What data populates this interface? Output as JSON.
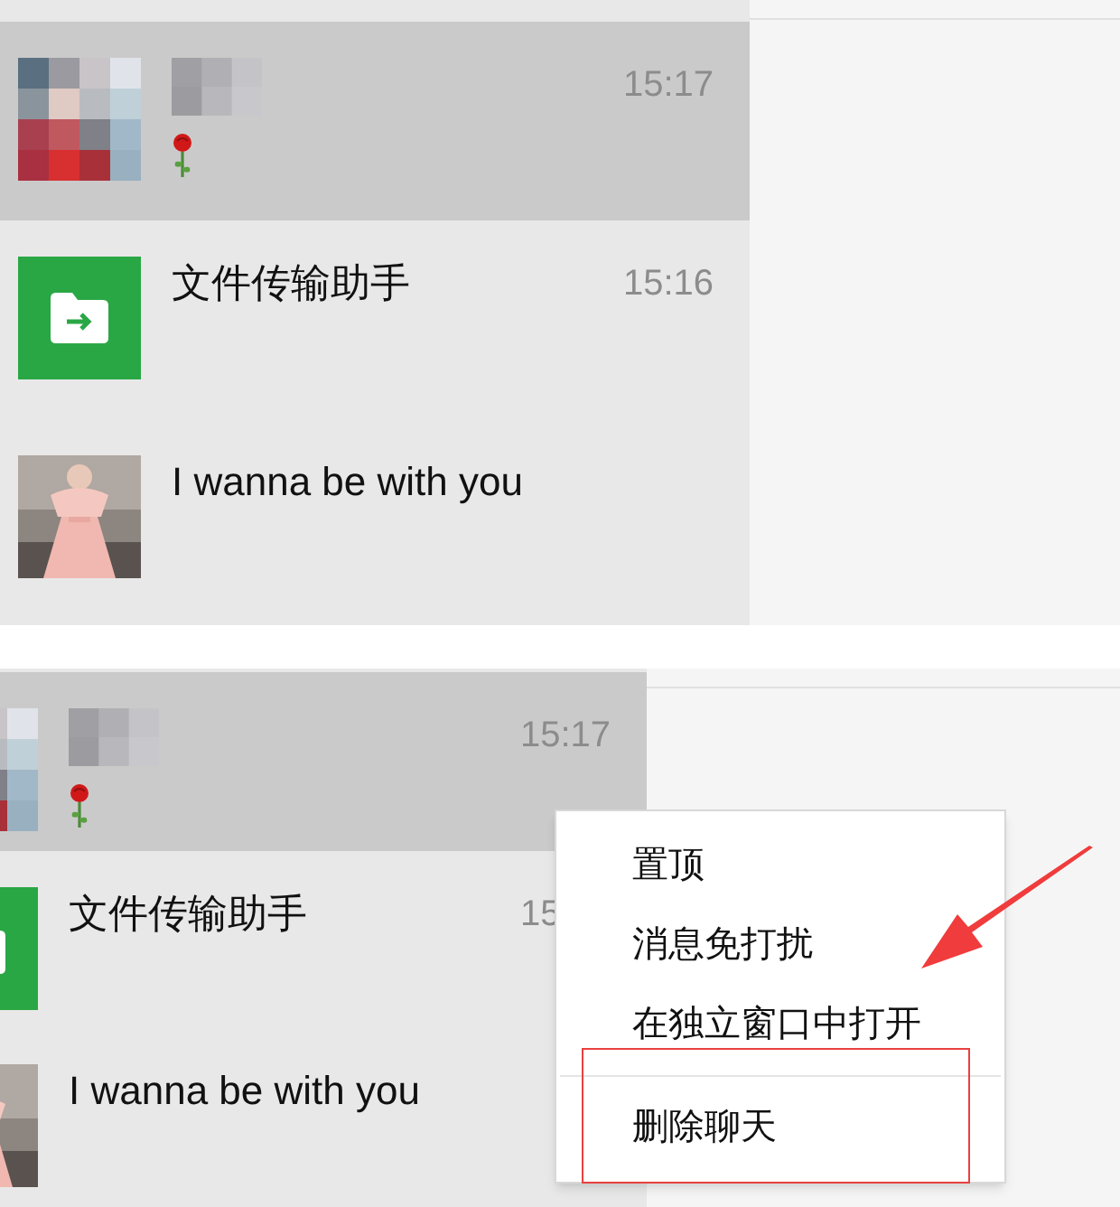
{
  "panels": [
    {
      "cropped": false,
      "chats": [
        {
          "name_mosaic": true,
          "time": "15:17",
          "preview": {
            "kind": "rose"
          },
          "selected": true
        },
        {
          "avatar": {
            "kind": "file-transfer"
          },
          "name_mosaic": false,
          "name": "文件传输助手",
          "time": "15:16",
          "selected": false
        },
        {
          "name_mosaic": false,
          "name": "I wanna be with you",
          "selected": false
        }
      ]
    },
    {
      "cropped": true,
      "chats": [
        {
          "name_mosaic": true,
          "time": "15:17",
          "preview": {
            "kind": "rose"
          },
          "selected": true
        },
        {
          "avatar": {
            "kind": "file-transfer"
          },
          "name_mosaic": false,
          "name": "文件传输助手",
          "time": "15",
          "selected": false
        },
        {
          "name_mosaic": false,
          "name": "I wanna be with you",
          "selected": false
        }
      ],
      "context_menu": {
        "items": [
          {
            "label": "置顶",
            "divider_before": false
          },
          {
            "label": "消息免打扰",
            "divider_before": false
          },
          {
            "label": "在独立窗口中打开",
            "divider_before": false
          },
          {
            "label": "删除聊天",
            "divider_before": true
          }
        ]
      },
      "annotation_arrow": true,
      "annotation_box": true
    }
  ]
}
